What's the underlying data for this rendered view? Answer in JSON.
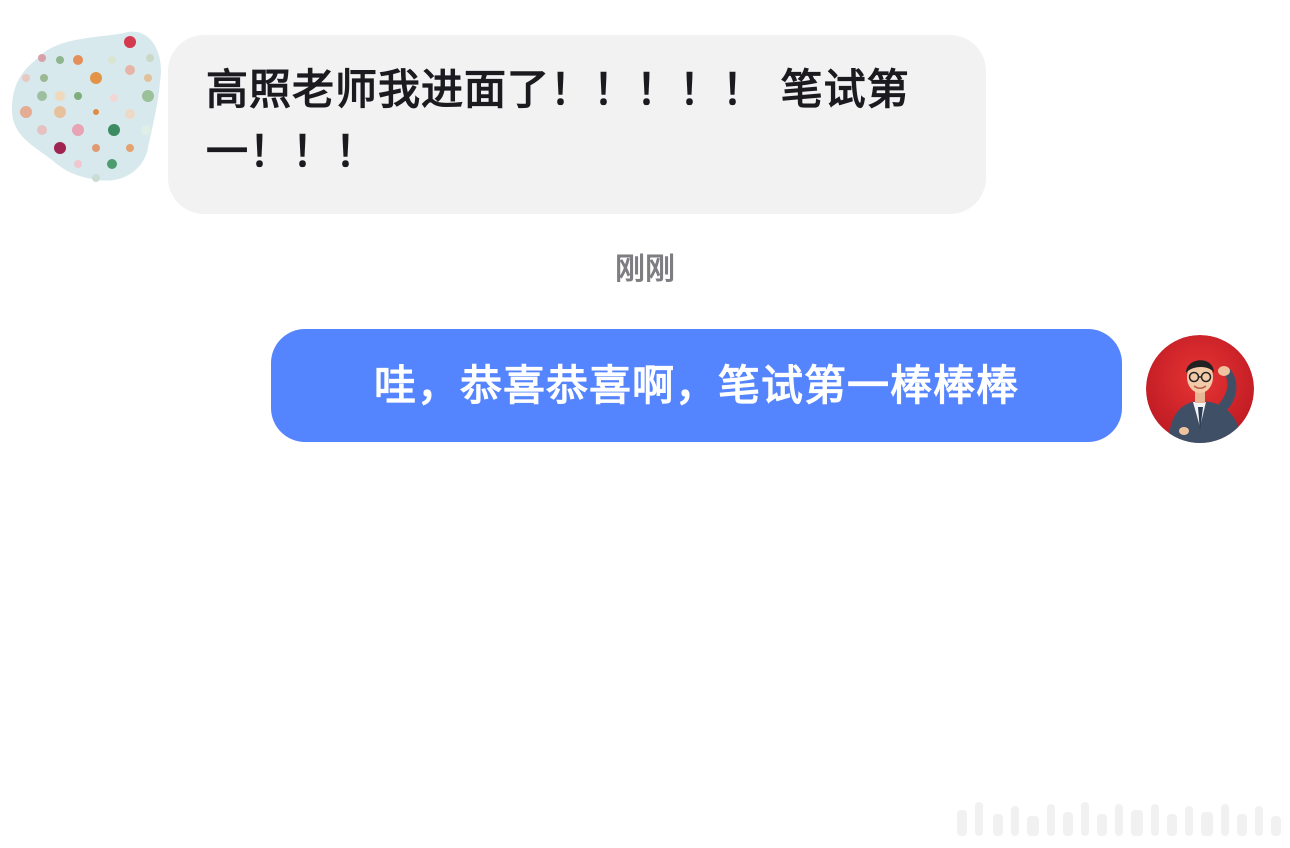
{
  "conversation": {
    "messages": [
      {
        "sender": "other",
        "text": "高照老师我进面了！！！！！ 笔试第一！！！"
      },
      {
        "sender": "self",
        "text": "哇，恭喜恭喜啊，笔试第一棒棒棒"
      }
    ],
    "timestamp": "刚刚"
  },
  "avatars": {
    "left": "polka-dot-avatar",
    "right": "teacher-photo-avatar"
  },
  "colors": {
    "incoming_bubble": "#f2f2f3",
    "outgoing_bubble": "#5584ff",
    "timestamp_text": "#7d7d82",
    "avatar_right_bg": "#d4202d"
  }
}
